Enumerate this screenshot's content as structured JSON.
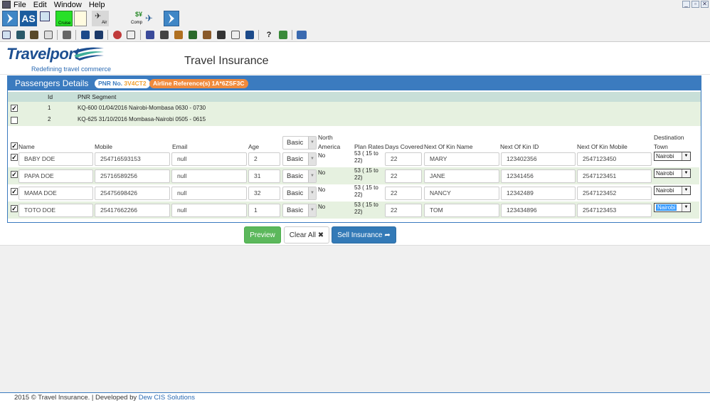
{
  "menu": {
    "file": "File",
    "edit": "Edit",
    "window": "Window",
    "help": "Help"
  },
  "toolbar": {
    "as_label": "AS",
    "cruise_label": "Cruise",
    "air_label": "Air",
    "comp_label": "Comp",
    "comp_symbol": "$¥"
  },
  "brand": {
    "name": "Travelport",
    "tagline": "Redefining travel commerce",
    "brand_color": "#1d4f91"
  },
  "page_title": "Travel Insurance",
  "panel": {
    "title": "Passengers Details",
    "pnr_label": "PNR No.",
    "pnr_value": "3V4CT2",
    "airline_ref": "Airline Reference(s) 1A*6ZSF3C",
    "header_color": "#3b7bbf"
  },
  "segments": {
    "headers": {
      "id": "Id",
      "segment": "PNR Segment"
    },
    "rows": [
      {
        "id": "1",
        "segment": "KQ-600 01/04/2016 Nairobi-Mombasa 0630 - 0730",
        "checked": "✓"
      },
      {
        "id": "2",
        "segment": "KQ-625 31/10/2016 Mombasa-Nairobi 0505 - 0615",
        "checked": ""
      }
    ]
  },
  "columns": {
    "name": "Name",
    "mobile": "Mobile",
    "email": "Email",
    "age": "Age",
    "plan_default": "Basic",
    "north_america_1": "North",
    "north_america_2": "America",
    "plan_rates": "Plan Rates",
    "days": "Days Covered",
    "kin_name": "Next Of Kin Name",
    "kin_id": "Next Of Kin ID",
    "kin_mobile": "Next Of Kin Mobile",
    "dest_1": "Destination",
    "dest_2": "Town"
  },
  "passengers": [
    {
      "name": "BABY DOE",
      "mobile": "254716593153",
      "email": "null",
      "age": "2",
      "plan": "Basic",
      "north_america": "No",
      "rate_1": "53 ( 15 to",
      "rate_2": "22)",
      "days": "22",
      "kin_name": "MARY",
      "kin_id": "123402356",
      "kin_mobile": "2547123450",
      "destination": "Nairobi"
    },
    {
      "name": "PAPA DOE",
      "mobile": "25716589256",
      "email": "null",
      "age": "31",
      "plan": "Basic",
      "north_america": "No",
      "rate_1": "53 ( 15 to",
      "rate_2": "22)",
      "days": "22",
      "kin_name": "JANE",
      "kin_id": "12341456",
      "kin_mobile": "2547123451",
      "destination": "Nairobi"
    },
    {
      "name": "MAMA DOE",
      "mobile": "25475698426",
      "email": "null",
      "age": "32",
      "plan": "Basic",
      "north_america": "No",
      "rate_1": "53 ( 15 to",
      "rate_2": "22)",
      "days": "22",
      "kin_name": "NANCY",
      "kin_id": "12342489",
      "kin_mobile": "2547123452",
      "destination": "Nairobi"
    },
    {
      "name": "TOTO DOE",
      "mobile": "25417662266",
      "email": "null",
      "age": "1",
      "plan": "Basic",
      "north_america": "No",
      "rate_1": "53 ( 15 to",
      "rate_2": "22)",
      "days": "22",
      "kin_name": "TOM",
      "kin_id": "123434896",
      "kin_mobile": "2547123453",
      "destination": "Nairobi"
    }
  ],
  "buttons": {
    "preview": "Preview",
    "clear_all": "Clear All ✖",
    "sell": "Sell Insurance ➦"
  },
  "footer": {
    "text": "2015 © Travel Insurance. | Developed by",
    "link": "Dew CIS Solutions"
  }
}
